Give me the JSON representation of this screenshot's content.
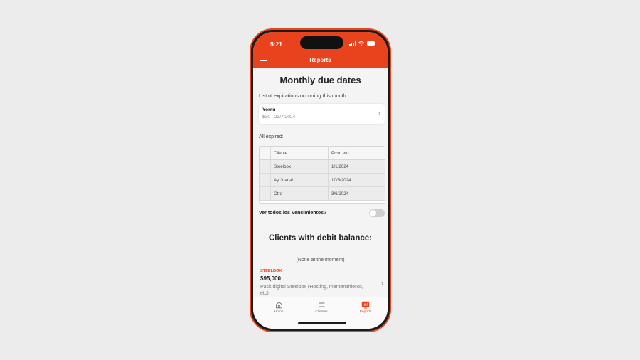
{
  "status_bar": {
    "time": "5:21"
  },
  "app_bar": {
    "title": "Reports"
  },
  "due_dates": {
    "title": "Monthly due dates",
    "description": "List of expirations occurring this month.",
    "card": {
      "name": "Yomu",
      "detail": "$30 · 23/7/2024"
    }
  },
  "expired": {
    "label": "All expired:",
    "columns": [
      "Cliente",
      "Prox. vto"
    ],
    "rows": [
      {
        "client": "Steelbox",
        "date": "1/1/2024"
      },
      {
        "client": "Ay Juana!",
        "date": "10/5/2024"
      },
      {
        "client": "Otro",
        "date": "3/6/2024"
      }
    ]
  },
  "toggle": {
    "label": "Ver todos los Vencimientos?",
    "on": false
  },
  "debit": {
    "title": "Clients with debit balance:",
    "none_message": "(None at the moment)",
    "item": {
      "client": "STEELBOX",
      "amount": "$95,000",
      "description": "Pack digital Steelbox (Hosting, mantenimiento, etc)"
    }
  },
  "tabs": [
    {
      "label": "Home",
      "icon": "home-icon",
      "active": false
    },
    {
      "label": "Clientes",
      "icon": "list-icon",
      "active": false
    },
    {
      "label": "Reports",
      "icon": "reports-icon",
      "active": true
    }
  ],
  "colors": {
    "accent": "#e8431c",
    "background": "#ececec"
  }
}
